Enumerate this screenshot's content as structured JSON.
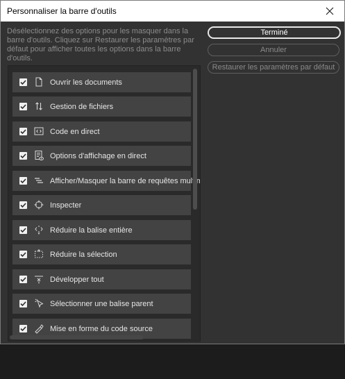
{
  "dialog": {
    "title": "Personnaliser la barre d'outils",
    "description": "Désélectionnez des options pour les masquer dans la barre d'outils. Cliquez sur Restaurer les paramètres par défaut pour afficher toutes les options dans la barre d'outils."
  },
  "buttons": {
    "done": "Terminé",
    "cancel": "Annuler",
    "restore": "Restaurer les paramètres par défaut"
  },
  "items": [
    {
      "label": "Ouvrir les documents",
      "icon": "document-icon",
      "checked": true
    },
    {
      "label": "Gestion de fichiers",
      "icon": "file-transfer-icon",
      "checked": true
    },
    {
      "label": "Code en direct",
      "icon": "live-code-icon",
      "checked": true
    },
    {
      "label": "Options d'affichage en direct",
      "icon": "live-view-options-icon",
      "checked": true
    },
    {
      "label": "Afficher/Masquer la barre de requêtes multiméd",
      "icon": "media-query-bar-icon",
      "checked": true
    },
    {
      "label": "Inspecter",
      "icon": "inspect-crosshair-icon",
      "checked": true
    },
    {
      "label": "Réduire la balise entière",
      "icon": "collapse-tag-icon",
      "checked": true
    },
    {
      "label": "Réduire la sélection",
      "icon": "collapse-selection-icon",
      "checked": true
    },
    {
      "label": "Développer tout",
      "icon": "expand-all-icon",
      "checked": true
    },
    {
      "label": "Sélectionner une balise parent",
      "icon": "select-parent-tag-icon",
      "checked": true
    },
    {
      "label": "Mise en forme du code source",
      "icon": "format-source-icon",
      "checked": true
    }
  ]
}
